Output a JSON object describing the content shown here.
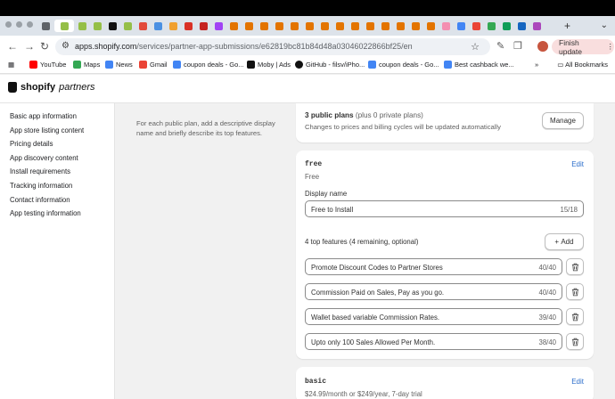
{
  "browser": {
    "url_host": "apps.shopify.com",
    "url_path": "/services/partner-app-submissions/e62819bc81b84d48a03046022866bf25/en",
    "finish_update_label": "Finish update",
    "all_bookmarks_label": "All Bookmarks",
    "bookmarks": [
      {
        "label": "YouTube",
        "color": "#ff0000"
      },
      {
        "label": "Maps",
        "color": "#34a853"
      },
      {
        "label": "News",
        "color": "#4285f4"
      },
      {
        "label": "Gmail",
        "color": "#ea4335"
      },
      {
        "label": "coupon deals - Go...",
        "color": "#4285f4"
      },
      {
        "label": "Moby | Ads",
        "color": "#111111"
      },
      {
        "label": "GitHub - filsv/iPho...",
        "color": "#111111"
      },
      {
        "label": "coupon deals - Go...",
        "color": "#4285f4"
      },
      {
        "label": "Best cashback we...",
        "color": "#4285f4"
      }
    ]
  },
  "header": {
    "brand_bold": "shopify",
    "brand_rest": "partners"
  },
  "sidebar": {
    "items": [
      {
        "label": "Basic app information"
      },
      {
        "label": "App store listing content"
      },
      {
        "label": "Pricing details"
      },
      {
        "label": "App discovery content"
      },
      {
        "label": "Install requirements"
      },
      {
        "label": "Tracking information"
      },
      {
        "label": "Contact information"
      },
      {
        "label": "App testing information"
      }
    ]
  },
  "main": {
    "description": "For each public plan, add a descriptive display name and briefly describe its top features.",
    "plans_summary": {
      "count_label": "3 public plans",
      "private_label": "(plus 0 private plans)",
      "subtitle": "Changes to prices and billing cycles will be updated automatically",
      "manage_label": "Manage"
    },
    "free_plan": {
      "name": "free",
      "edit_label": "Edit",
      "price": "Free",
      "display_name_label": "Display name",
      "display_name_value": "Free to Install",
      "display_name_count": "15/18",
      "features_title": "4 top features (4 remaining, optional)",
      "add_label": "Add",
      "features": [
        {
          "value": "Promote Discount Codes to Partner Stores",
          "count": "40/40"
        },
        {
          "value": "Commission Paid on Sales, Pay as you go.",
          "count": "40/40"
        },
        {
          "value": "Wallet based variable Commission Rates.",
          "count": "39/40"
        },
        {
          "value": "Upto only 100 Sales Allowed Per Month.",
          "count": "38/40"
        }
      ]
    },
    "basic_plan": {
      "name": "basic",
      "edit_label": "Edit",
      "price": "$24.99/month or $249/year, 7-day trial"
    }
  }
}
